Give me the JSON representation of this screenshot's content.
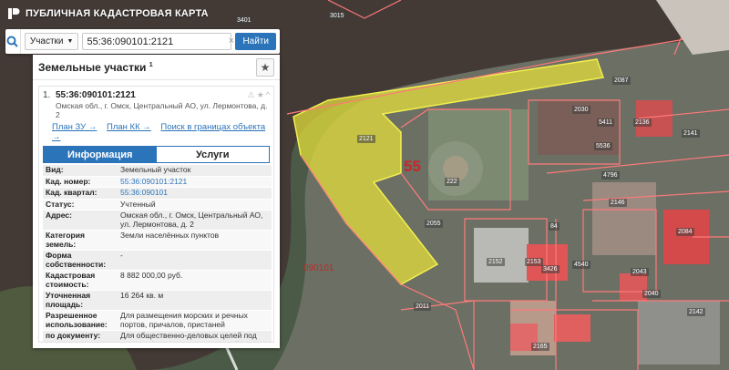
{
  "app": {
    "title": "ПУБЛИЧНАЯ КАДАСТРОВАЯ КАРТА"
  },
  "search": {
    "type_label": "Участки",
    "value": "55:36:090101:2121",
    "placeholder": "",
    "clear_symbol": "×",
    "find_label": "Найти"
  },
  "panel": {
    "title": "Земельные участки",
    "count": "1",
    "star_symbol": "★"
  },
  "result": {
    "index": "1.",
    "cad_number": "55:36:090101:2121",
    "address": "Омская обл., г. Омск, Центральный АО, ул. Лермонтова, д. 2",
    "links": [
      "План ЗУ →",
      "План КК →",
      "Поиск в границах объекта →"
    ],
    "icons": [
      "⚠",
      "★",
      "^"
    ]
  },
  "tabs": {
    "info": "Информация",
    "services": "Услуги"
  },
  "attributes": [
    {
      "key": "Вид:",
      "value": "Земельный участок",
      "is_link": false
    },
    {
      "key": "Кад. номер:",
      "value": "55:36:090101:2121",
      "is_link": true
    },
    {
      "key": "Кад. квартал:",
      "value": "55:36:090101",
      "is_link": true
    },
    {
      "key": "Статус:",
      "value": "Учтенный",
      "is_link": false
    },
    {
      "key": "Адрес:",
      "value": "Омская обл., г. Омск, Центральный АО, ул. Лермонтова, д. 2",
      "is_link": false
    },
    {
      "key": "Категория земель:",
      "value": "Земли населённых пунктов",
      "is_link": false
    },
    {
      "key": "Форма собственности:",
      "value": "-",
      "is_link": false
    },
    {
      "key": "Кадастровая стоимость:",
      "value": "8 882 000,00 руб.",
      "is_link": false
    },
    {
      "key": "Уточненная площадь:",
      "value": "16 264 кв. м",
      "is_link": false
    },
    {
      "key": "Разрешенное использование:",
      "value": "Для размещения морских и речных портов, причалов, пристаней",
      "is_link": false
    },
    {
      "key": "по документу:",
      "value": "Для общественно-деловых целей под здание, фактически занимаемый речным вокзалом и причалами",
      "is_link": false
    }
  ],
  "map": {
    "district_label": "55",
    "quarter_label": "090101",
    "plot_numbers": [
      "3401",
      "3015",
      "2087",
      "2030",
      "5411",
      "2136",
      "2141",
      "5536",
      "2121",
      "222",
      "4796",
      "2146",
      "2055",
      "84",
      "2084",
      "2152",
      "2153",
      "3426",
      "4540",
      "2043",
      "2040",
      "2142",
      "2165",
      "2011"
    ]
  },
  "colors": {
    "accent": "#2b74b9",
    "selection": "#e8e23a",
    "boundary": "#ff6b6b",
    "river": "#433a36"
  }
}
